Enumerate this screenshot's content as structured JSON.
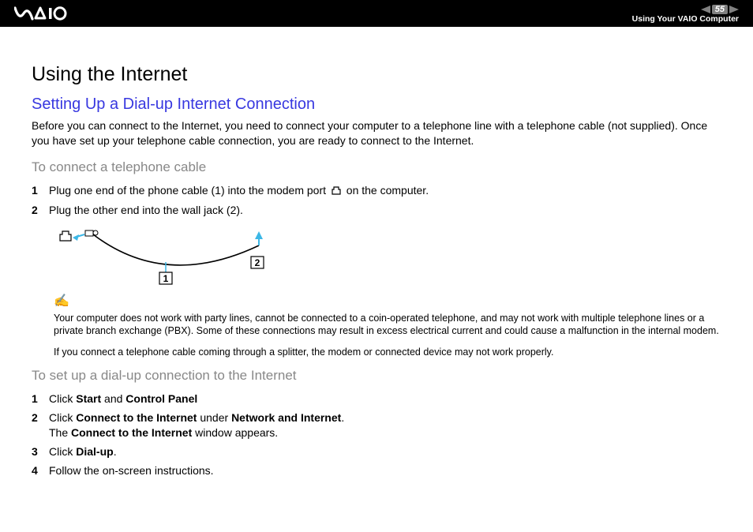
{
  "header": {
    "page_number": "55",
    "subtitle": "Using Your VAIO Computer"
  },
  "h1": "Using the Internet",
  "h2": "Setting Up a Dial-up Internet Connection",
  "intro": "Before you can connect to the Internet, you need to connect your computer to a telephone line with a telephone cable (not supplied). Once you have set up your telephone cable connection, you are ready to connect to the Internet.",
  "h3a": "To connect a telephone cable",
  "steps_a": [
    {
      "n": "1",
      "pre": "Plug one end of the phone cable (1) into the modem port ",
      "post": " on the computer."
    },
    {
      "n": "2",
      "pre": "Plug the other end into the wall jack (2).",
      "post": ""
    }
  ],
  "diagram_labels": {
    "one": "1",
    "two": "2"
  },
  "note1": "Your computer does not work with party lines, cannot be connected to a coin-operated telephone, and may not work with multiple telephone lines or a private branch exchange (PBX). Some of these connections may result in excess electrical current and could cause a malfunction in the internal modem.",
  "note2": "If you connect a telephone cable coming through a splitter, the modem or connected device may not work properly.",
  "h3b": "To set up a dial-up connection to the Internet",
  "steps_b": [
    {
      "n": "1",
      "parts": [
        "Click ",
        "Start",
        " and ",
        "Control Panel"
      ]
    },
    {
      "n": "2",
      "parts": [
        "Click ",
        "Connect to the Internet",
        " under ",
        "Network and Internet",
        ".\nThe ",
        "Connect to the Internet",
        " window appears."
      ]
    },
    {
      "n": "3",
      "parts": [
        "Click ",
        "Dial-up",
        "."
      ]
    },
    {
      "n": "4",
      "parts": [
        "Follow the on-screen instructions."
      ]
    }
  ]
}
